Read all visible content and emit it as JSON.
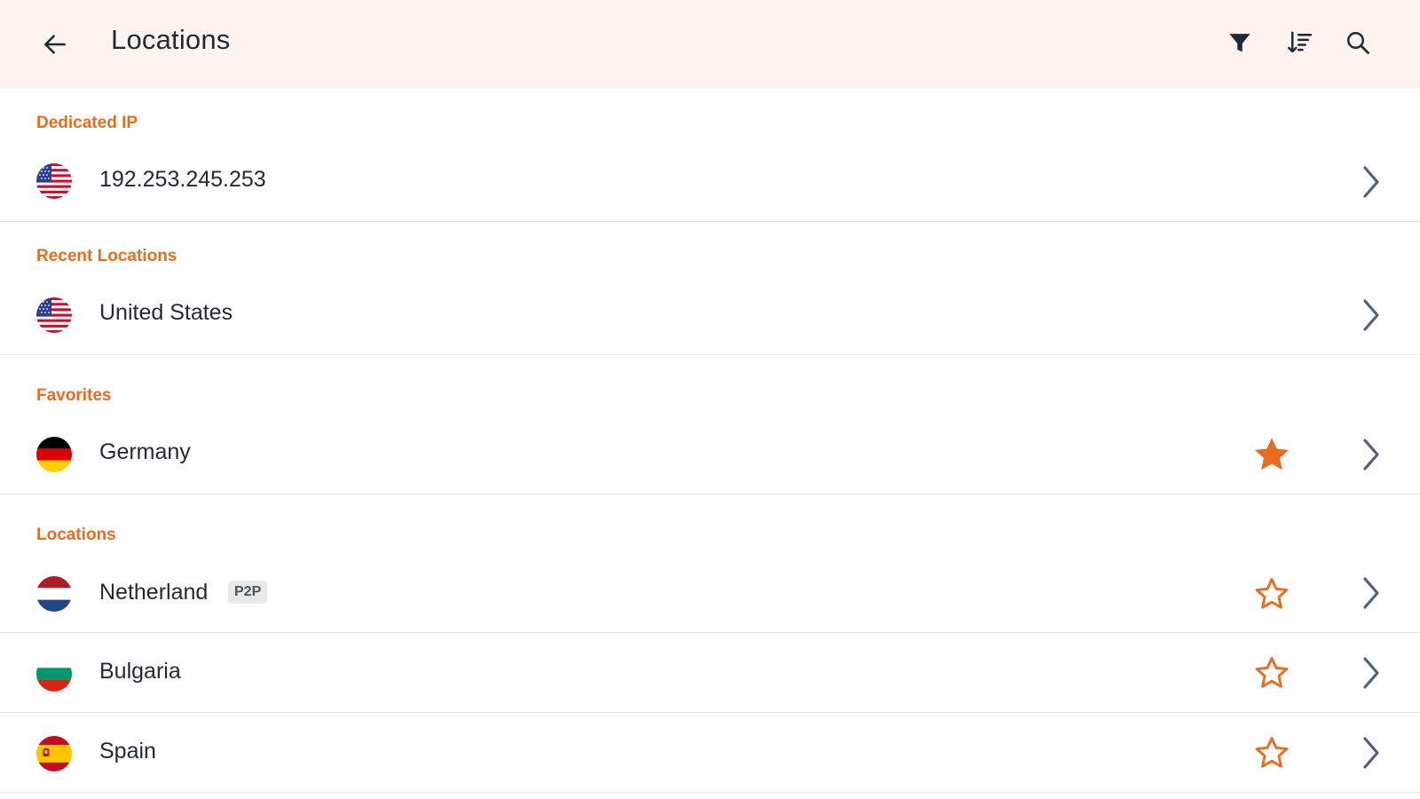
{
  "header": {
    "title": "Locations",
    "back_icon": "arrow-left-icon",
    "actions": [
      "filter-icon",
      "sort-icon",
      "search-icon"
    ]
  },
  "colors": {
    "accent": "#e86c1f",
    "header_bg": "#fdf4ef",
    "text": "#1f2a36",
    "chevron": "#4f6378",
    "divider": "#e3e3e3"
  },
  "sections": {
    "dedicated": {
      "title": "Dedicated IP",
      "items": [
        {
          "name": "192.253.245.253",
          "flag": "united-states-flag"
        }
      ]
    },
    "recent": {
      "title": "Recent Locations",
      "items": [
        {
          "name": "United States",
          "flag": "united-states-flag"
        }
      ]
    },
    "favorites": {
      "title": "Favorites",
      "items": [
        {
          "name": "Germany",
          "flag": "germany-flag",
          "favorite": true
        }
      ]
    },
    "locations": {
      "title": "Locations",
      "items": [
        {
          "name": "Netherland",
          "flag": "netherlands-flag",
          "tag": "P2P",
          "favorite": false
        },
        {
          "name": "Bulgaria",
          "flag": "bulgaria-flag",
          "favorite": false
        },
        {
          "name": "Spain",
          "flag": "spain-flag",
          "favorite": false
        }
      ]
    }
  }
}
